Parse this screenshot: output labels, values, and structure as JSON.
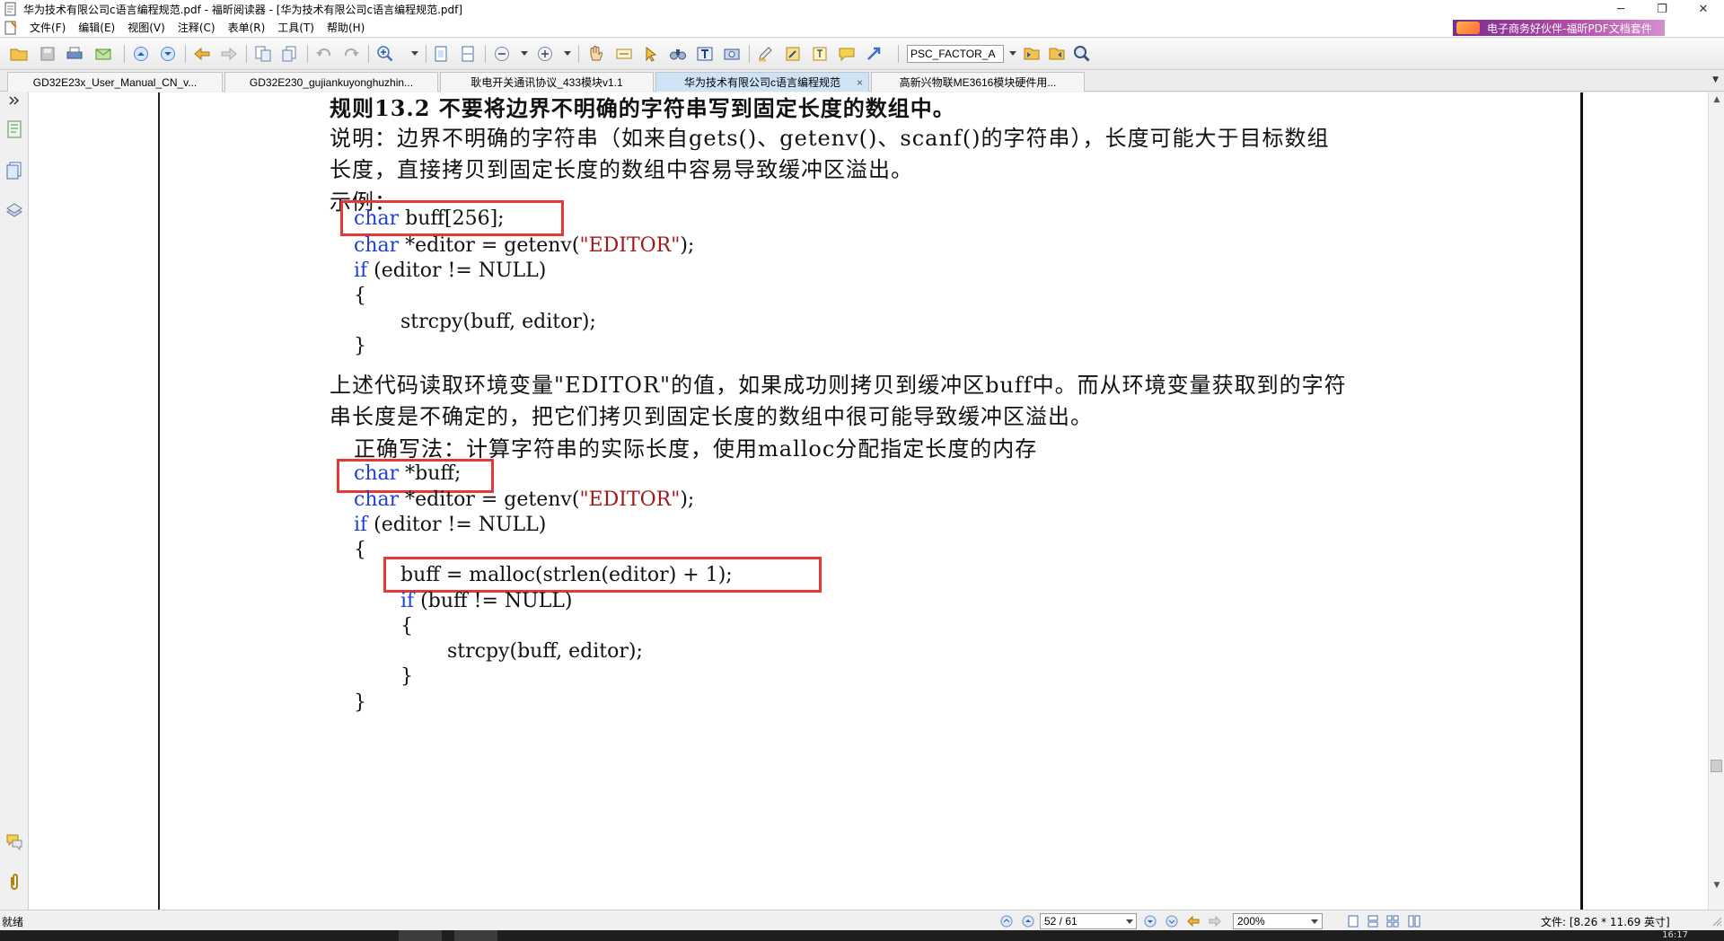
{
  "window": {
    "title": "华为技术有限公司c语言编程规范.pdf - 福昕阅读器 - [华为技术有限公司c语言编程规范.pdf]",
    "minimize_glyph": "─",
    "restore_glyph": "❐",
    "close_glyph": "✕"
  },
  "menu": {
    "items": [
      "文件(F)",
      "编辑(E)",
      "视图(V)",
      "注释(C)",
      "表单(R)",
      "工具(T)",
      "帮助(H)"
    ],
    "banner_text": "电子商务好伙伴-福昕PDF文档套件"
  },
  "toolbar": {
    "search_value": "PSC_FACTOR_A"
  },
  "tabs": [
    {
      "label": "GD32E23x_User_Manual_CN_v...",
      "active": false
    },
    {
      "label": "GD32E230_gujiankuyonghuzhin...",
      "active": false
    },
    {
      "label": "耿电开关通讯协议_433模块v1.1",
      "active": false
    },
    {
      "label": "华为技术有限公司c语言编程规范",
      "active": true
    },
    {
      "label": "高新兴物联ME3616模块硬件用...",
      "active": false
    }
  ],
  "tab_close_glyph": "×",
  "tab_menu_glyph": "▼",
  "document": {
    "rule_heading": "规则13.2 不要将边界不明确的字符串写到固定长度的数组中。",
    "desc_line1": "说明：边界不明确的字符串（如来自gets()、getenv()、scanf()的字符串），长度可能大于目标数组",
    "desc_line2": "长度，直接拷贝到固定长度的数组中容易导致缓冲区溢出。",
    "example_label": "示例：",
    "code1": {
      "l1_kw": "char",
      "l1_rest": " buff[256];",
      "l2_kw": "char",
      "l2_mid": " *editor = getenv(",
      "l2_str": "\"EDITOR\"",
      "l2_end": ");",
      "l3_kw": "if",
      "l3_rest": " (editor != NULL)",
      "l4": "{",
      "l5": "strcpy(buff, editor);",
      "l6": "}"
    },
    "after_line1": "上述代码读取环境变量\"EDITOR\"的值，如果成功则拷贝到缓冲区buff中。而从环境变量获取到的字符",
    "after_line2": "串长度是不确定的，把它们拷贝到固定长度的数组中很可能导致缓冲区溢出。",
    "correct_label": "正确写法：计算字符串的实际长度，使用malloc分配指定长度的内存",
    "code2": {
      "l1_kw": "char",
      "l1_rest": " *buff;",
      "l2_kw": "char",
      "l2_mid": " *editor = getenv(",
      "l2_str": "\"EDITOR\"",
      "l2_end": ");",
      "l3_kw": "if",
      "l3_rest": " (editor != NULL)",
      "l4": "{",
      "l5": "buff = malloc(strlen(editor) + 1);",
      "l6_kw": "if",
      "l6_rest": " (buff != NULL)",
      "l7": "{",
      "l8": "strcpy(buff, editor);",
      "l9": "}",
      "l10": "}"
    }
  },
  "statusbar": {
    "status": "就绪",
    "page_value": "52 / 61",
    "zoom_value": "200%",
    "page_size": "文件: [8.26 * 11.69 英寸]",
    "clock": "16:17"
  },
  "colors": {
    "keyword": "#1c3fd8",
    "string": "#a01818",
    "highlight_box": "#e53935",
    "active_tab": "#cfe3f7"
  }
}
